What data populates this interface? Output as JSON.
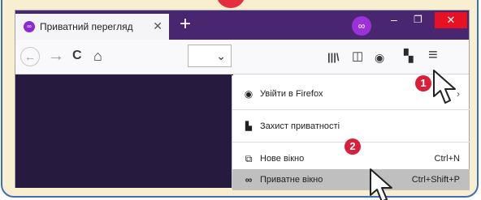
{
  "tab": {
    "label": "Приватний перегляд",
    "close_glyph": "✕"
  },
  "new_tab_glyph": "+",
  "window_controls": {
    "minimize": "–",
    "maximize": "❐",
    "close": "✕"
  },
  "nav": {
    "back": "←",
    "forward": "→",
    "reload": "C",
    "home": "⌂",
    "dropdown": "⌄",
    "library": "|||\\",
    "sidebar": "◫",
    "account": "◉",
    "extensions": "▚",
    "menu": "≡"
  },
  "menu": {
    "items": [
      {
        "label": "Увійти в Firefox",
        "icon": "account-icon",
        "chevron": "›"
      },
      {
        "label": "Захист приватності",
        "icon": "privacy-dashboard-icon"
      },
      {
        "label": "Нове вікно",
        "icon": "new-window-icon",
        "shortcut": "Ctrl+N"
      },
      {
        "label": "Приватне вікно",
        "icon": "private-mask-icon",
        "shortcut": "Ctrl+Shift+P"
      }
    ]
  },
  "badges": {
    "first": "1",
    "second": "2"
  },
  "colors": {
    "accent_purple": "#4a2670",
    "badge_red": "#d8203b",
    "frame_blue": "#3d6fb8"
  }
}
